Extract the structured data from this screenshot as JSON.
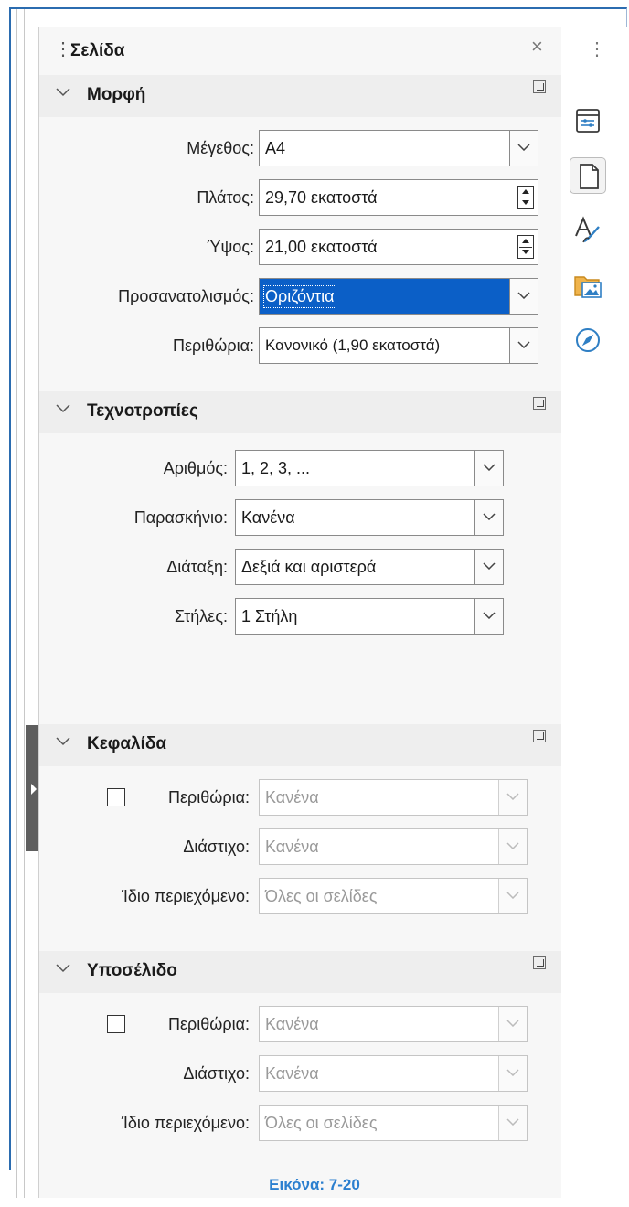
{
  "panel": {
    "title": "Σελίδα",
    "close_icon": "close-icon"
  },
  "format": {
    "title": "Μορφή",
    "size_label": "Μέγεθος:",
    "size_value": "A4",
    "width_label": "Πλάτος:",
    "width_value": "29,70 εκατοστά",
    "height_label": "Ύψος:",
    "height_value": "21,00 εκατοστά",
    "orientation_label": "Προσανατολισμός:",
    "orientation_value": "Οριζόντια",
    "margins_label": "Περιθώρια:",
    "margins_value": "Κανονικό (1,90 εκατοστά)"
  },
  "styles": {
    "title": "Τεχνοτροπίες",
    "number_label": "Αριθμός:",
    "number_value": "1, 2, 3, ...",
    "background_label": "Παρασκήνιο:",
    "background_value": "Κανένα",
    "layout_label": "Διάταξη:",
    "layout_value": "Δεξιά και αριστερά",
    "columns_label": "Στήλες:",
    "columns_value": "1 Στήλη"
  },
  "header": {
    "title": "Κεφαλίδα",
    "margins_label": "Περιθώρια:",
    "margins_value": "Κανένα",
    "margins_checked": false,
    "spacing_label": "Διάστιχο:",
    "spacing_value": "Κανένα",
    "same_content_label": "Ίδιο περιεχόμενο:",
    "same_content_value": "Όλες οι σελίδες"
  },
  "footer": {
    "title": "Υποσέλιδο",
    "margins_label": "Περιθώρια:",
    "margins_value": "Κανένα",
    "margins_checked": false,
    "spacing_label": "Διάστιχο:",
    "spacing_value": "Κανένα",
    "same_content_label": "Ίδιο περιεχόμενο:",
    "same_content_value": "Όλες οι σελίδες"
  },
  "tabbar": {
    "items": [
      "properties-icon",
      "page-icon",
      "styles-icon",
      "gallery-icon",
      "navigator-icon"
    ],
    "active": "page-icon"
  },
  "colors": {
    "selection": "#0b5fc7",
    "caption": "#2b7fcf",
    "frame": "#2b6cb0"
  },
  "caption": "Εικόνα: 7-20"
}
